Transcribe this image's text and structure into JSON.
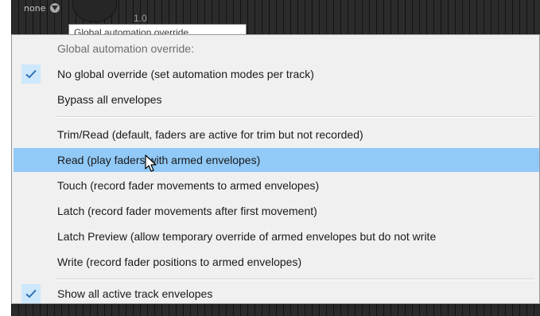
{
  "background": {
    "mode_label": "none",
    "value_label": "1.0",
    "tooltip": "Global automation override"
  },
  "menu": {
    "header": "Global automation override:",
    "items": [
      {
        "label": "No global override (set automation modes per track)",
        "checked": true
      },
      {
        "label": "Bypass all envelopes",
        "checked": false
      },
      {
        "label": "Trim/Read (default, faders are active for trim but not recorded)",
        "checked": false
      },
      {
        "label": "Read (play faders with armed envelopes)",
        "checked": false,
        "highlighted": true
      },
      {
        "label": "Touch (record fader movements to armed envelopes)",
        "checked": false
      },
      {
        "label": "Latch (record fader movements after first movement)",
        "checked": false
      },
      {
        "label": "Latch Preview (allow temporary override of armed envelopes but do not write",
        "checked": false
      },
      {
        "label": "Write (record fader positions to armed envelopes)",
        "checked": false
      },
      {
        "label": "Show all active track envelopes",
        "checked": true
      }
    ]
  },
  "colors": {
    "highlight": "#91c9f7",
    "check_bg": "#cde8fb",
    "check_mark": "#2f6fb5",
    "menu_bg": "#f0f0f0"
  }
}
